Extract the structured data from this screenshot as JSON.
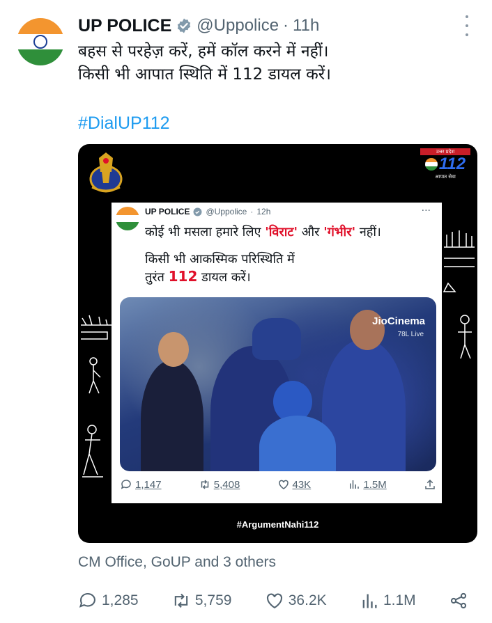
{
  "tweet": {
    "author_name": "UP POLICE",
    "handle": "@Uppolice",
    "separator": "·",
    "time": "11h",
    "text_line1": "बहस से परहेज़ करें, हमें कॉल करने में नहीं।",
    "text_line2": "किसी भी आपात स्थिति में 112 डायल करें।",
    "hashtag": "#DialUP112",
    "social_context": "CM Office, GoUP and 3 others",
    "actions": {
      "replies": "1,285",
      "retweets": "5,759",
      "likes": "36.2K",
      "views": "1.1M"
    }
  },
  "media": {
    "logo112_top": "उत्तर प्रदेश",
    "logo112_number": "112",
    "logo112_bottom": "आपात सेवा",
    "footer_hashtag": "#ArgumentNahi112",
    "inner_tweet": {
      "name": "UP POLICE",
      "handle": "@Uppolice",
      "separator": "·",
      "time": "12h",
      "line1_pre": "कोई भी मसला हमारे लिए ",
      "line1_red1": "'विराट'",
      "line1_mid": " और ",
      "line1_red2": "'गंभीर'",
      "line1_post": " नहीं।",
      "line2": "किसी भी आकस्मिक परिस्थिति में",
      "line3_pre": "तुरंत ",
      "line3_red": "112",
      "line3_post": " डायल करें।",
      "photo_brand": "JioCinema",
      "photo_live": "78L Live",
      "stats": {
        "replies": "1,147",
        "retweets": "5,408",
        "likes": "43K",
        "views": "1.5M"
      }
    }
  },
  "colors": {
    "accent": "#1d9bf0",
    "text": "#0f1419",
    "muted": "#536471",
    "red": "#e0102a",
    "saffron": "#f3952f",
    "green": "#2f8f3a"
  }
}
